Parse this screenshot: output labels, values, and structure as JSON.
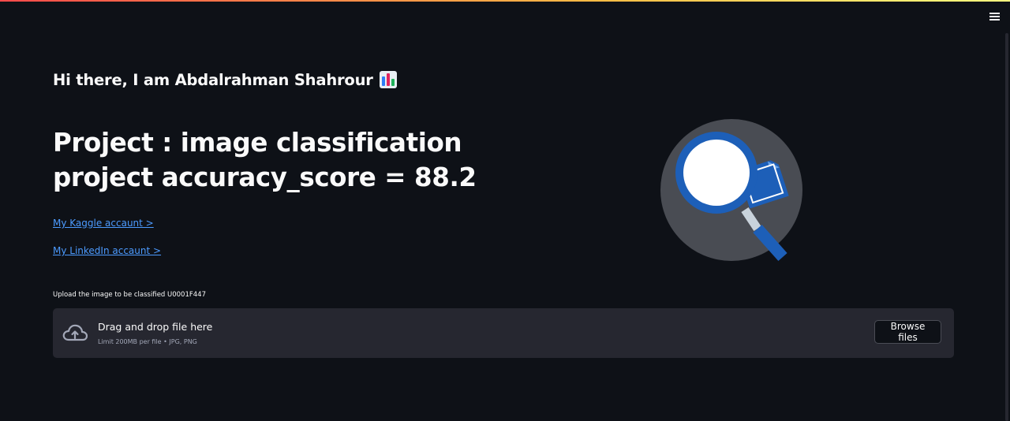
{
  "header": {
    "accent_gradient": [
      "#ff4b4b",
      "#ffbd45",
      "#fffd80"
    ],
    "menu_icon": "hamburger-menu-icon"
  },
  "main": {
    "greeting": "Hi there, I am Abdalrahman Shahrour",
    "greeting_icon": "bar-chart-emoji-icon",
    "project_title_line1": "Project : image classification",
    "project_title_line2": "project accuracy_score = 88.2",
    "links": {
      "kaggle": "My Kaggle accaunt >",
      "linkedin": "My LinkedIn accaunt >"
    },
    "illustration_icon": "magnifying-glass-icon"
  },
  "uploader": {
    "label": "Upload the image to be classified U0001F447",
    "drop_title": "Drag and drop file here",
    "drop_subtitle": "Limit 200MB per file • JPG, PNG",
    "browse_label": "Browse files",
    "icon": "cloud-upload-icon"
  },
  "colors": {
    "background": "#0e1117",
    "surface": "#262730",
    "link": "#4c9bff",
    "text": "#fafafa",
    "muted": "#a3a8b8"
  }
}
